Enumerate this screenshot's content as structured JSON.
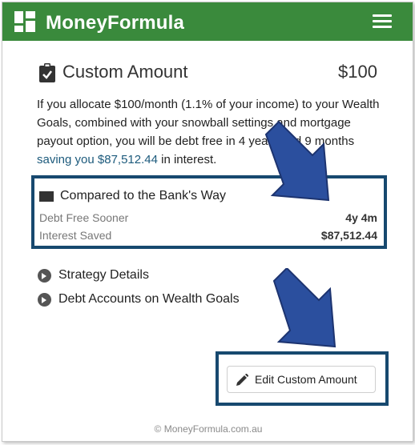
{
  "navbar": {
    "brand": "MoneyFormula"
  },
  "card": {
    "title": "Custom Amount",
    "amount": "$100",
    "paragraph_before": "If you allocate $100/month (1.1% of your income) to your Wealth Goals, combined with your snowball settings and mortgage payout option, you will be debt free in 4 years and 9 months ",
    "paragraph_em": "saving you $87,512.44",
    "paragraph_after": " in interest."
  },
  "compare": {
    "heading": "Compared to the Bank's Way",
    "rows": [
      {
        "label": "Debt Free Sooner",
        "value": "4y 4m"
      },
      {
        "label": "Interest Saved",
        "value": "$87,512.44"
      }
    ]
  },
  "accordions": [
    {
      "label": "Strategy Details"
    },
    {
      "label": "Debt Accounts on Wealth Goals"
    }
  ],
  "edit_button": {
    "label": "Edit Custom Amount"
  },
  "footer": {
    "text": "© MoneyFormula.com.au"
  },
  "colors": {
    "navbar": "#3a8a3c",
    "highlight_border": "#17496f",
    "arrow": "#2b4f9e"
  }
}
